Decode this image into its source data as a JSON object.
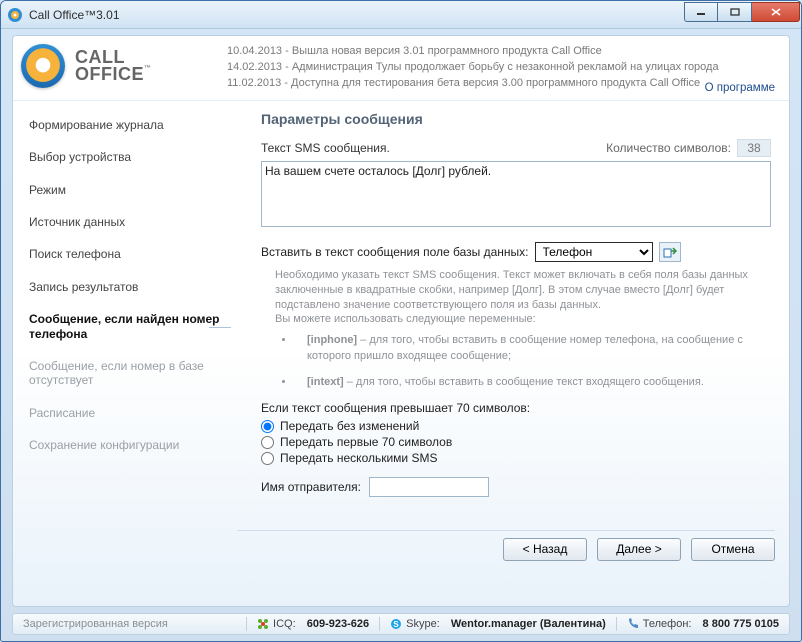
{
  "window": {
    "title": "Call Office™3.01"
  },
  "logo": {
    "line1": "CALL",
    "line2": "OFFICE"
  },
  "news": [
    "10.04.2013 - Вышла новая версия 3.01 программного продукта Call Office",
    "14.02.2013 - Администрация Тулы продолжает борьбу с незаконной рекламой на улицах города",
    "11.02.2013 - Доступна для тестирования бета версия 3.00 программного продукта Call Office"
  ],
  "about_link": "О программе",
  "sidebar": [
    {
      "label": "Формирование журнала",
      "active": false,
      "disabled": false
    },
    {
      "label": "Выбор устройства",
      "active": false,
      "disabled": false
    },
    {
      "label": "Режим",
      "active": false,
      "disabled": false
    },
    {
      "label": "Источник данных",
      "active": false,
      "disabled": false
    },
    {
      "label": "Поиск телефона",
      "active": false,
      "disabled": false
    },
    {
      "label": "Запись результатов",
      "active": false,
      "disabled": false
    },
    {
      "label": "Сообщение, если найден номер телефона",
      "active": true,
      "disabled": false
    },
    {
      "label": "Сообщение, если номер в базе отсутствует",
      "active": false,
      "disabled": true
    },
    {
      "label": "Расписание",
      "active": false,
      "disabled": true
    },
    {
      "label": "Сохранение конфигурации",
      "active": false,
      "disabled": true
    }
  ],
  "content": {
    "title": "Параметры сообщения",
    "sms_label": "Текст SMS сообщения.",
    "charcount_label": "Количество символов:",
    "charcount_value": "38",
    "sms_text": "На вашем счете осталось [Долг] рублей.",
    "insert_label": "Вставить в текст сообщения поле базы данных:",
    "db_field_selected": "Телефон",
    "help_para": "Необходимо указать текст SMS сообщения. Текст может включать в себя поля базы данных заключенные в квадратные скобки, например [Долг]. В этом случае вместо [Долг] будет подставлено значение соответствующего поля из базы данных.\nВы можете использовать следующие переменные:",
    "help_items": [
      {
        "tag": "[inphone]",
        "desc": " – для того, чтобы вставить в сообщение номер телефона, на сообщение с которого пришло входящее сообщение;"
      },
      {
        "tag": "[intext]",
        "desc": " – для того, чтобы вставить в сообщение текст входящего сообщения."
      }
    ],
    "limit_heading": "Если текст сообщения превышает 70 символов:",
    "limit_options": [
      "Передать без изменений",
      "Передать первые 70 символов",
      "Передать несколькими SMS"
    ],
    "limit_selected": 0,
    "sender_label": "Имя отправителя:",
    "sender_value": ""
  },
  "nav": {
    "back": "< Назад",
    "next": "Далее >",
    "cancel": "Отмена"
  },
  "status": {
    "registered": "Зарегистрированная версия",
    "icq_label": "ICQ:",
    "icq": "609-923-626",
    "skype_label": "Skype:",
    "skype": "Wentor.manager (Валентина)",
    "phone_label": "Телефон:",
    "phone": "8 800 775 0105"
  }
}
